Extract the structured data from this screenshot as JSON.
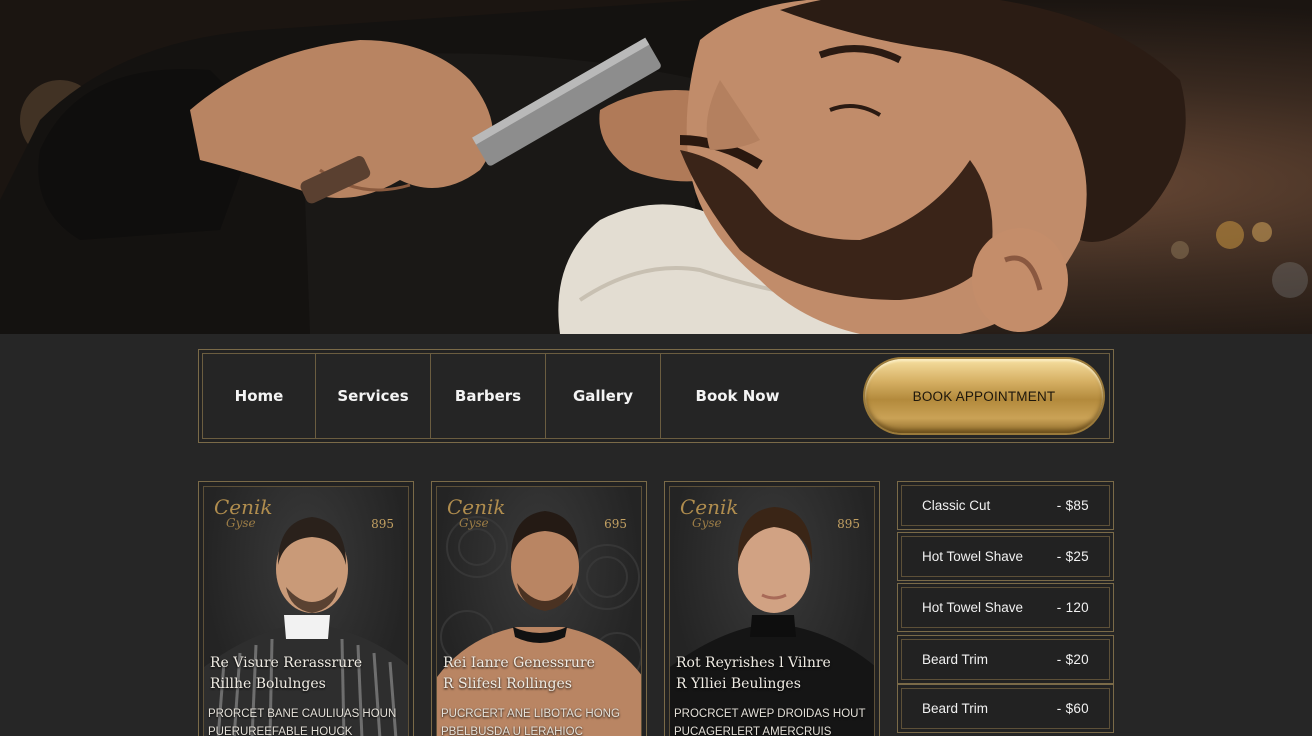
{
  "nav": {
    "items": [
      {
        "label": "Home"
      },
      {
        "label": "Services"
      },
      {
        "label": "Barbers"
      },
      {
        "label": "Gallery"
      },
      {
        "label": "Book Now"
      }
    ],
    "cta_label": "BOOK APPOINTMENT"
  },
  "cards": [
    {
      "logo": "Cenik",
      "logo_sub": "Gyse",
      "price": "895",
      "title_line1": "Re Visure Rerassrure",
      "title_line2": "Rillhe Bolulnges",
      "desc_line1": "PRORCET BANE CAULIUAS HOUN",
      "desc_line2": "PUERUREEFABLE HOUCK"
    },
    {
      "logo": "Cenik",
      "logo_sub": "Gyse",
      "price": "695",
      "title_line1": "Rei Ianre Genessrure",
      "title_line2": "R Slifesl Rollinges",
      "desc_line1": "PUCRCERT ANE LIBOTAC HONG",
      "desc_line2": "PBELBUSDA U LERAHIOC"
    },
    {
      "logo": "Cenik",
      "logo_sub": "Gyse",
      "price": "895",
      "title_line1": "Rot Reyrishes l Vilnre",
      "title_line2": "R Ylliei Beulinges",
      "desc_line1": "PROCRCET AWEP DROIDAS HOUT",
      "desc_line2": "PUCAGERLERT AMERCRUIS"
    }
  ],
  "services": [
    {
      "name": "Classic Cut",
      "price": "- $85"
    },
    {
      "name": "Hot Towel Shave",
      "price": "- $25"
    },
    {
      "name": "Hot Towel Shave",
      "price": "- 120"
    },
    {
      "name": "Beard Trim",
      "price": "- $20"
    },
    {
      "name": "Beard Trim",
      "price": "- $60"
    }
  ],
  "colors": {
    "background": "#262626",
    "gold_accent": "#b8924a",
    "border": "#7a6a48"
  }
}
